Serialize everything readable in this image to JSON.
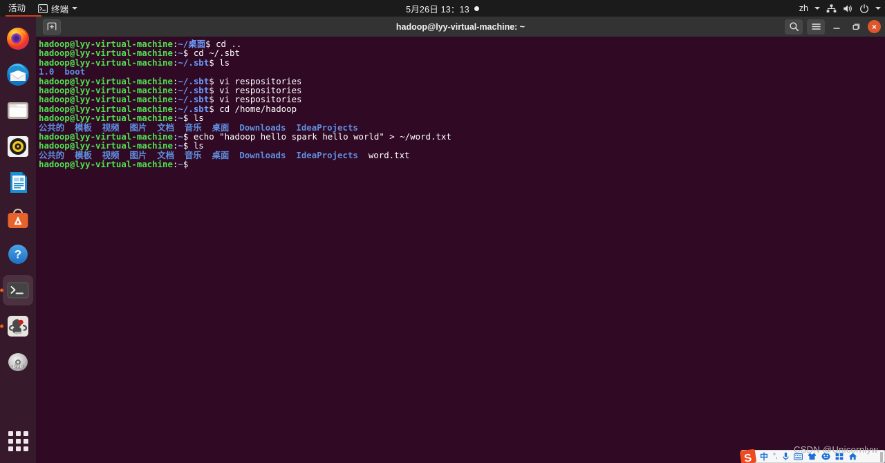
{
  "topbar": {
    "activities": "活动",
    "app_name": "终端",
    "clock": "5月26日  13：13",
    "language": "zh",
    "icons": [
      "terminal-icon",
      "chevron-down-icon",
      "clock-dot-icon",
      "network-icon",
      "volume-icon",
      "power-icon",
      "chevron-down-icon"
    ]
  },
  "dock": {
    "items": [
      {
        "name": "firefox",
        "label": "Firefox",
        "running": false,
        "active": false
      },
      {
        "name": "thunderbird",
        "label": "Thunderbird Mail",
        "running": false,
        "active": false
      },
      {
        "name": "files",
        "label": "Files",
        "running": false,
        "active": false
      },
      {
        "name": "rhythmbox",
        "label": "Rhythmbox",
        "running": false,
        "active": false
      },
      {
        "name": "libreoffice-writer",
        "label": "LibreOffice Writer",
        "running": false,
        "active": false
      },
      {
        "name": "ubuntu-software",
        "label": "Ubuntu Software",
        "running": false,
        "active": false
      },
      {
        "name": "help",
        "label": "Help",
        "running": false,
        "active": false
      },
      {
        "name": "terminal",
        "label": "Terminal",
        "running": true,
        "active": true
      },
      {
        "name": "intellij-idea",
        "label": "IntelliJ IDEA",
        "running": true,
        "active": false
      },
      {
        "name": "dvd-drive",
        "label": "DVD",
        "running": false,
        "active": false
      }
    ],
    "show_apps_label": "显示应用程序"
  },
  "terminal": {
    "title": "hadoop@lyy-virtual-machine: ~",
    "new_tab_label": "新建终端",
    "search_label": "搜索",
    "menu_label": "菜单",
    "minimize_label": "最小化",
    "maximize_label": "还原",
    "close_label": "×",
    "prompt": {
      "user_host": "hadoop@lyy-virtual-machine",
      "colon": ":",
      "sigil": "$"
    },
    "lines": [
      {
        "type": "prompt",
        "path": "~/桌面",
        "command": " cd .."
      },
      {
        "type": "prompt",
        "path": "~",
        "command": " cd ~/.sbt"
      },
      {
        "type": "prompt",
        "path": "~/.sbt",
        "command": " ls"
      },
      {
        "type": "output",
        "items": [
          {
            "text": "1.0",
            "kind": "dir"
          },
          {
            "text": "  ",
            "kind": "gap"
          },
          {
            "text": "boot",
            "kind": "dir"
          }
        ]
      },
      {
        "type": "prompt",
        "path": "~/.sbt",
        "command": " vi respositories"
      },
      {
        "type": "prompt",
        "path": "~/.sbt",
        "command": " vi respositories"
      },
      {
        "type": "prompt",
        "path": "~/.sbt",
        "command": " vi respositories"
      },
      {
        "type": "prompt",
        "path": "~/.sbt",
        "command": " cd /home/hadoop"
      },
      {
        "type": "prompt",
        "path": "~",
        "command": " ls"
      },
      {
        "type": "output",
        "items": [
          {
            "text": "公共的",
            "kind": "dir"
          },
          {
            "text": "  ",
            "kind": "gap"
          },
          {
            "text": "模板",
            "kind": "dir"
          },
          {
            "text": "  ",
            "kind": "gap"
          },
          {
            "text": "视频",
            "kind": "dir"
          },
          {
            "text": "  ",
            "kind": "gap"
          },
          {
            "text": "图片",
            "kind": "dir"
          },
          {
            "text": "  ",
            "kind": "gap"
          },
          {
            "text": "文档",
            "kind": "dir"
          },
          {
            "text": "  ",
            "kind": "gap"
          },
          {
            "text": "音乐",
            "kind": "dir"
          },
          {
            "text": "  ",
            "kind": "gap"
          },
          {
            "text": "桌面",
            "kind": "dir"
          },
          {
            "text": "  ",
            "kind": "gap"
          },
          {
            "text": "Downloads",
            "kind": "dir"
          },
          {
            "text": "  ",
            "kind": "gap"
          },
          {
            "text": "IdeaProjects",
            "kind": "dir"
          }
        ]
      },
      {
        "type": "prompt",
        "path": "~",
        "command": " echo \"hadoop hello spark hello world\" > ~/word.txt"
      },
      {
        "type": "prompt",
        "path": "~",
        "command": " ls"
      },
      {
        "type": "output",
        "items": [
          {
            "text": "公共的",
            "kind": "dir"
          },
          {
            "text": "  ",
            "kind": "gap"
          },
          {
            "text": "模板",
            "kind": "dir"
          },
          {
            "text": "  ",
            "kind": "gap"
          },
          {
            "text": "视频",
            "kind": "dir"
          },
          {
            "text": "  ",
            "kind": "gap"
          },
          {
            "text": "图片",
            "kind": "dir"
          },
          {
            "text": "  ",
            "kind": "gap"
          },
          {
            "text": "文档",
            "kind": "dir"
          },
          {
            "text": "  ",
            "kind": "gap"
          },
          {
            "text": "音乐",
            "kind": "dir"
          },
          {
            "text": "  ",
            "kind": "gap"
          },
          {
            "text": "桌面",
            "kind": "dir"
          },
          {
            "text": "  ",
            "kind": "gap"
          },
          {
            "text": "Downloads",
            "kind": "dir"
          },
          {
            "text": "  ",
            "kind": "gap"
          },
          {
            "text": "IdeaProjects",
            "kind": "dir"
          },
          {
            "text": "  ",
            "kind": "gap"
          },
          {
            "text": "word.txt",
            "kind": "file"
          }
        ]
      },
      {
        "type": "prompt",
        "path": "~",
        "command": ""
      }
    ]
  },
  "ime": {
    "name": "sogou-input-method",
    "mode_label": "中",
    "punct_label": "°,",
    "icons": [
      "sogou-logo-icon",
      "chinese-mode-icon",
      "punctuation-icon",
      "microphone-icon",
      "keyboard-icon",
      "skin-icon",
      "emoji-icon",
      "toolbox-icon",
      "home-icon"
    ]
  },
  "watermark": {
    "text": "CSDN @Unicornlyw"
  },
  "colors": {
    "terminal_bg": "#300a24",
    "prompt_user": "#4ee24e",
    "prompt_path": "#6b9cff",
    "dir_blue": "#5f8fe0",
    "header_bg": "#333333",
    "topbar_bg": "#1b1b1b",
    "dock_bg": "#2e1021",
    "close_btn": "#e0562c",
    "accent_orange": "#e8601c"
  }
}
